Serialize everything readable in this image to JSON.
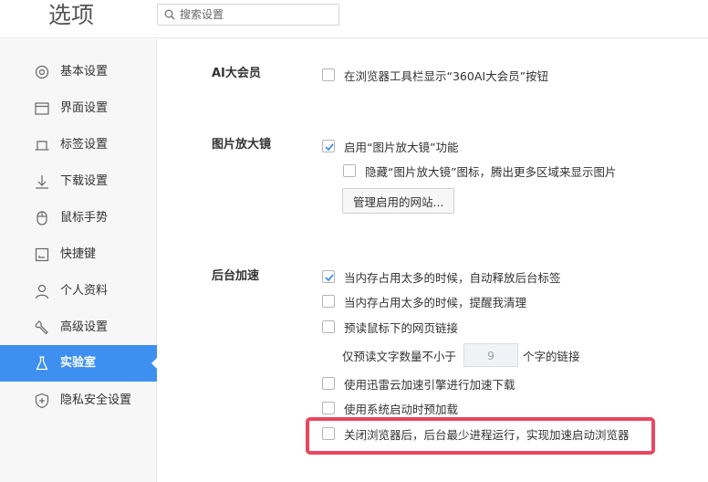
{
  "header": {
    "title": "选项",
    "search_placeholder": "搜索设置"
  },
  "sidebar": {
    "items": [
      {
        "label": "基本设置",
        "icon": "gear-icon"
      },
      {
        "label": "界面设置",
        "icon": "window-icon"
      },
      {
        "label": "标签设置",
        "icon": "tab-icon"
      },
      {
        "label": "下载设置",
        "icon": "download-icon"
      },
      {
        "label": "鼠标手势",
        "icon": "mouse-icon"
      },
      {
        "label": "快捷键",
        "icon": "keyboard-icon"
      },
      {
        "label": "个人资料",
        "icon": "person-icon"
      },
      {
        "label": "高级设置",
        "icon": "wrench-icon"
      },
      {
        "label": "实验室",
        "icon": "flask-icon",
        "active": true
      },
      {
        "label": "隐私安全设置",
        "icon": "shield-icon"
      }
    ],
    "active_color": "#3d8ff0"
  },
  "main": {
    "ai_member": {
      "title": "AI大会员",
      "options": [
        {
          "label": "在浏览器工具栏显示“360AI大会员”按钮",
          "checked": false
        }
      ]
    },
    "magnifier": {
      "title": "图片放大镜",
      "options": [
        {
          "label": "启用“图片放大镜”功能",
          "checked": true
        },
        {
          "label": "隐藏“图片放大镜”图标，腾出更多区域来显示图片",
          "checked": false
        }
      ],
      "manage_button": "管理启用的网站..."
    },
    "acceleration": {
      "title": "后台加速",
      "options": [
        {
          "label": "当内存占用太多的时候，自动释放后台标签",
          "checked": true
        },
        {
          "label": "当内存占用太多的时候，提醒我清理",
          "checked": false
        },
        {
          "label": "预读鼠标下的网页链接",
          "checked": false
        },
        {
          "label": "使用迅雷云加速引擎进行加速下载",
          "checked": false
        },
        {
          "label": "使用系统启动时预加载",
          "checked": false
        },
        {
          "label": "关闭浏览器后，后台最少进程运行，实现加速启动浏览器",
          "checked": false
        }
      ],
      "prefetch_prefix": "仅预读文字数量不小于",
      "prefetch_value": "9",
      "prefetch_suffix": "个字的链接"
    },
    "highlight_color": "#e8475f"
  }
}
